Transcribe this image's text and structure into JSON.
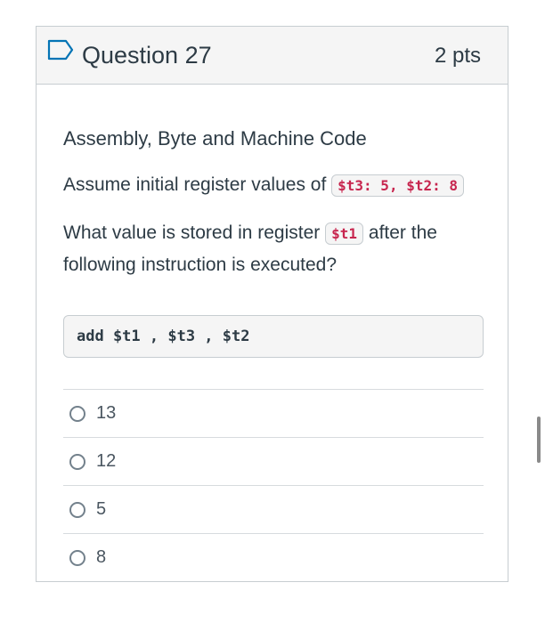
{
  "question": {
    "title": "Question 27",
    "points": "2 pts",
    "heading": "Assembly, Byte and Machine Code",
    "line1_text": "Assume initial register values of",
    "line1_code": "$t3: 5, $t2: 8",
    "line2_before": "What value is stored in register",
    "line2_code": "$t1",
    "line2_after": "after the following instruction is executed?",
    "instruction": "add $t1 , $t3 , $t2"
  },
  "answers": [
    {
      "label": "13"
    },
    {
      "label": "12"
    },
    {
      "label": "5"
    },
    {
      "label": "8"
    }
  ],
  "icons": {
    "flag": "bookmark-flag-icon"
  },
  "colors": {
    "accent": "#0374b5",
    "code_red": "#c7254e"
  }
}
